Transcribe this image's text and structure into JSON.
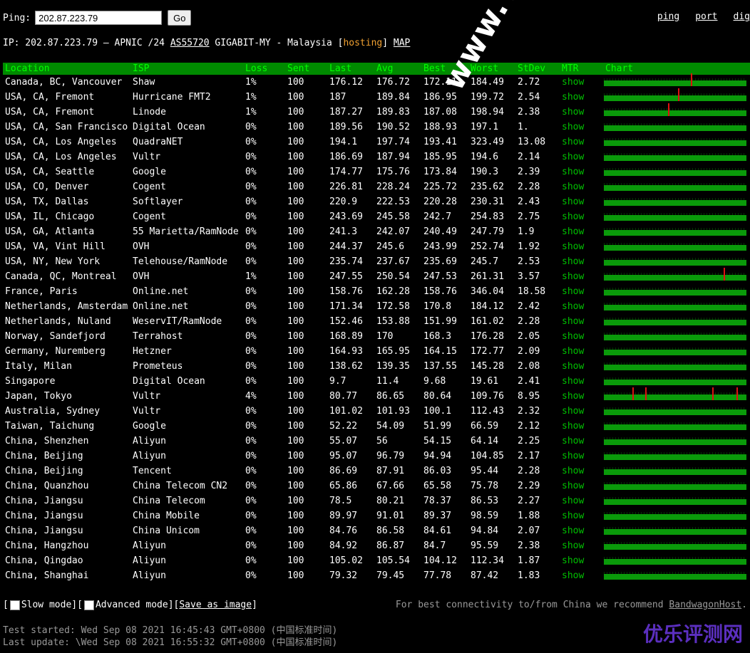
{
  "ping": {
    "label": "Ping:",
    "value": "202.87.223.79",
    "go_label": "Go"
  },
  "nav": {
    "links": [
      "ping",
      "port",
      "dig"
    ]
  },
  "info": {
    "prefix": "IP: 202.87.223.79 – APNIC /24 ",
    "asn": "AS55720",
    "mid": " GIGABIT-MY - Malaysia [",
    "tag": "hosting",
    "end": "] ",
    "map": "MAP"
  },
  "columns": [
    "Location",
    "ISP",
    "Loss",
    "Sent",
    "Last",
    "Avg",
    "Best",
    "Worst",
    "StDev",
    "MTR",
    "Chart"
  ],
  "rows": [
    {
      "loc": "Canada, BC, Vancouver",
      "isp": "Shaw",
      "loss": "1%",
      "sent": "100",
      "last": "176.12",
      "avg": "176.72",
      "best": "172.11",
      "worst": "184.49",
      "stdev": "2.72",
      "mtr": "show"
    },
    {
      "loc": "USA, CA, Fremont",
      "isp": "Hurricane FMT2",
      "loss": "1%",
      "sent": "100",
      "last": "187",
      "avg": "189.84",
      "best": "186.95",
      "worst": "199.72",
      "stdev": "2.54",
      "mtr": "show"
    },
    {
      "loc": "USA, CA, Fremont",
      "isp": "Linode",
      "loss": "1%",
      "sent": "100",
      "last": "187.27",
      "avg": "189.83",
      "best": "187.08",
      "worst": "198.94",
      "stdev": "2.38",
      "mtr": "show"
    },
    {
      "loc": "USA, CA, San Francisco",
      "isp": "Digital Ocean",
      "loss": "0%",
      "sent": "100",
      "last": "189.56",
      "avg": "190.52",
      "best": "188.93",
      "worst": "197.1",
      "stdev": "1.",
      "mtr": "show"
    },
    {
      "loc": "USA, CA, Los Angeles",
      "isp": "QuadraNET",
      "loss": "0%",
      "sent": "100",
      "last": "194.1",
      "avg": "197.74",
      "best": "193.41",
      "worst": "323.49",
      "stdev": "13.08",
      "mtr": "show"
    },
    {
      "loc": "USA, CA, Los Angeles",
      "isp": "Vultr",
      "loss": "0%",
      "sent": "100",
      "last": "186.69",
      "avg": "187.94",
      "best": "185.95",
      "worst": "194.6",
      "stdev": "2.14",
      "mtr": "show"
    },
    {
      "loc": "USA, CA, Seattle",
      "isp": "Google",
      "loss": "0%",
      "sent": "100",
      "last": "174.77",
      "avg": "175.76",
      "best": "173.84",
      "worst": "190.3",
      "stdev": "2.39",
      "mtr": "show"
    },
    {
      "loc": "USA, CO, Denver",
      "isp": "Cogent",
      "loss": "0%",
      "sent": "100",
      "last": "226.81",
      "avg": "228.24",
      "best": "225.72",
      "worst": "235.62",
      "stdev": "2.28",
      "mtr": "show"
    },
    {
      "loc": "USA, TX, Dallas",
      "isp": "Softlayer",
      "loss": "0%",
      "sent": "100",
      "last": "220.9",
      "avg": "222.53",
      "best": "220.28",
      "worst": "230.31",
      "stdev": "2.43",
      "mtr": "show"
    },
    {
      "loc": "USA, IL, Chicago",
      "isp": "Cogent",
      "loss": "0%",
      "sent": "100",
      "last": "243.69",
      "avg": "245.58",
      "best": "242.7",
      "worst": "254.83",
      "stdev": "2.75",
      "mtr": "show"
    },
    {
      "loc": "USA, GA, Atlanta",
      "isp": "55 Marietta/RamNode",
      "loss": "0%",
      "sent": "100",
      "last": "241.3",
      "avg": "242.07",
      "best": "240.49",
      "worst": "247.79",
      "stdev": "1.9",
      "mtr": "show"
    },
    {
      "loc": "USA, VA, Vint Hill",
      "isp": "OVH",
      "loss": "0%",
      "sent": "100",
      "last": "244.37",
      "avg": "245.6",
      "best": "243.99",
      "worst": "252.74",
      "stdev": "1.92",
      "mtr": "show"
    },
    {
      "loc": "USA, NY, New York",
      "isp": "Telehouse/RamNode",
      "loss": "0%",
      "sent": "100",
      "last": "235.74",
      "avg": "237.67",
      "best": "235.69",
      "worst": "245.7",
      "stdev": "2.53",
      "mtr": "show"
    },
    {
      "loc": "Canada, QC, Montreal",
      "isp": "OVH",
      "loss": "1%",
      "sent": "100",
      "last": "247.55",
      "avg": "250.54",
      "best": "247.53",
      "worst": "261.31",
      "stdev": "3.57",
      "mtr": "show"
    },
    {
      "loc": "France, Paris",
      "isp": "Online.net",
      "loss": "0%",
      "sent": "100",
      "last": "158.76",
      "avg": "162.28",
      "best": "158.76",
      "worst": "346.04",
      "stdev": "18.58",
      "mtr": "show"
    },
    {
      "loc": "Netherlands, Amsterdam",
      "isp": "Online.net",
      "loss": "0%",
      "sent": "100",
      "last": "171.34",
      "avg": "172.58",
      "best": "170.8",
      "worst": "184.12",
      "stdev": "2.42",
      "mtr": "show"
    },
    {
      "loc": "Netherlands, Nuland",
      "isp": "WeservIT/RamNode",
      "loss": "0%",
      "sent": "100",
      "last": "152.46",
      "avg": "153.88",
      "best": "151.99",
      "worst": "161.02",
      "stdev": "2.28",
      "mtr": "show"
    },
    {
      "loc": "Norway, Sandefjord",
      "isp": "Terrahost",
      "loss": "0%",
      "sent": "100",
      "last": "168.89",
      "avg": "170",
      "best": "168.3",
      "worst": "176.28",
      "stdev": "2.05",
      "mtr": "show"
    },
    {
      "loc": "Germany, Nuremberg",
      "isp": "Hetzner",
      "loss": "0%",
      "sent": "100",
      "last": "164.93",
      "avg": "165.95",
      "best": "164.15",
      "worst": "172.77",
      "stdev": "2.09",
      "mtr": "show"
    },
    {
      "loc": "Italy, Milan",
      "isp": "Prometeus",
      "loss": "0%",
      "sent": "100",
      "last": "138.62",
      "avg": "139.35",
      "best": "137.55",
      "worst": "145.28",
      "stdev": "2.08",
      "mtr": "show"
    },
    {
      "loc": "Singapore",
      "isp": "Digital Ocean",
      "loss": "0%",
      "sent": "100",
      "last": "9.7",
      "avg": "11.4",
      "best": "9.68",
      "worst": "19.61",
      "stdev": "2.41",
      "mtr": "show"
    },
    {
      "loc": "Japan, Tokyo",
      "isp": "Vultr",
      "loss": "4%",
      "sent": "100",
      "last": "80.77",
      "avg": "86.65",
      "best": "80.64",
      "worst": "109.76",
      "stdev": "8.95",
      "mtr": "show"
    },
    {
      "loc": "Australia, Sydney",
      "isp": "Vultr",
      "loss": "0%",
      "sent": "100",
      "last": "101.02",
      "avg": "101.93",
      "best": "100.1",
      "worst": "112.43",
      "stdev": "2.32",
      "mtr": "show"
    },
    {
      "loc": "Taiwan, Taichung",
      "isp": "Google",
      "loss": "0%",
      "sent": "100",
      "last": "52.22",
      "avg": "54.09",
      "best": "51.99",
      "worst": "66.59",
      "stdev": "2.12",
      "mtr": "show"
    },
    {
      "loc": "China, Shenzhen",
      "isp": "Aliyun",
      "loss": "0%",
      "sent": "100",
      "last": "55.07",
      "avg": "56",
      "best": "54.15",
      "worst": "64.14",
      "stdev": "2.25",
      "mtr": "show"
    },
    {
      "loc": "China, Beijing",
      "isp": "Aliyun",
      "loss": "0%",
      "sent": "100",
      "last": "95.07",
      "avg": "96.79",
      "best": "94.94",
      "worst": "104.85",
      "stdev": "2.17",
      "mtr": "show"
    },
    {
      "loc": "China, Beijing",
      "isp": "Tencent",
      "loss": "0%",
      "sent": "100",
      "last": "86.69",
      "avg": "87.91",
      "best": "86.03",
      "worst": "95.44",
      "stdev": "2.28",
      "mtr": "show"
    },
    {
      "loc": "China, Quanzhou",
      "isp": "China Telecom CN2",
      "loss": "0%",
      "sent": "100",
      "last": "65.86",
      "avg": "67.66",
      "best": "65.58",
      "worst": "75.78",
      "stdev": "2.29",
      "mtr": "show"
    },
    {
      "loc": "China, Jiangsu",
      "isp": "China Telecom",
      "loss": "0%",
      "sent": "100",
      "last": "78.5",
      "avg": "80.21",
      "best": "78.37",
      "worst": "86.53",
      "stdev": "2.27",
      "mtr": "show"
    },
    {
      "loc": "China, Jiangsu",
      "isp": "China Mobile",
      "loss": "0%",
      "sent": "100",
      "last": "89.97",
      "avg": "91.01",
      "best": "89.37",
      "worst": "98.59",
      "stdev": "1.88",
      "mtr": "show"
    },
    {
      "loc": "China, Jiangsu",
      "isp": "China Unicom",
      "loss": "0%",
      "sent": "100",
      "last": "84.76",
      "avg": "86.58",
      "best": "84.61",
      "worst": "94.84",
      "stdev": "2.07",
      "mtr": "show"
    },
    {
      "loc": "China, Hangzhou",
      "isp": "Aliyun",
      "loss": "0%",
      "sent": "100",
      "last": "84.92",
      "avg": "86.87",
      "best": "84.7",
      "worst": "95.59",
      "stdev": "2.38",
      "mtr": "show"
    },
    {
      "loc": "China, Qingdao",
      "isp": "Aliyun",
      "loss": "0%",
      "sent": "100",
      "last": "105.02",
      "avg": "105.54",
      "best": "104.12",
      "worst": "112.34",
      "stdev": "1.87",
      "mtr": "show"
    },
    {
      "loc": "China, Shanghai",
      "isp": "Aliyun",
      "loss": "0%",
      "sent": "100",
      "last": "79.32",
      "avg": "79.45",
      "best": "77.78",
      "worst": "87.42",
      "stdev": "1.83",
      "mtr": "show"
    }
  ],
  "controls": {
    "slow": "Slow mode",
    "advanced": "Advanced mode",
    "save": "Save as image"
  },
  "recommend": {
    "text": "For best connectivity to/from China we recommend ",
    "link": "BandwagonHost",
    "end": "."
  },
  "times": {
    "started": "Test started: Wed Sep 08 2021 16:45:43 GMT+0800 (中国标准时间)",
    "updated": "Last update: \\Wed Sep 08 2021 16:55:32 GMT+0800 (中国标准时间)"
  },
  "watermark": {
    "diagonal": "www.veidc.com",
    "corner": "优乐评测网"
  },
  "colors": {
    "header_bg": "#008a00",
    "bar": "#0a9a0a",
    "spike": "#e01010",
    "show": "#00c000",
    "hosting": "#f0a030"
  }
}
